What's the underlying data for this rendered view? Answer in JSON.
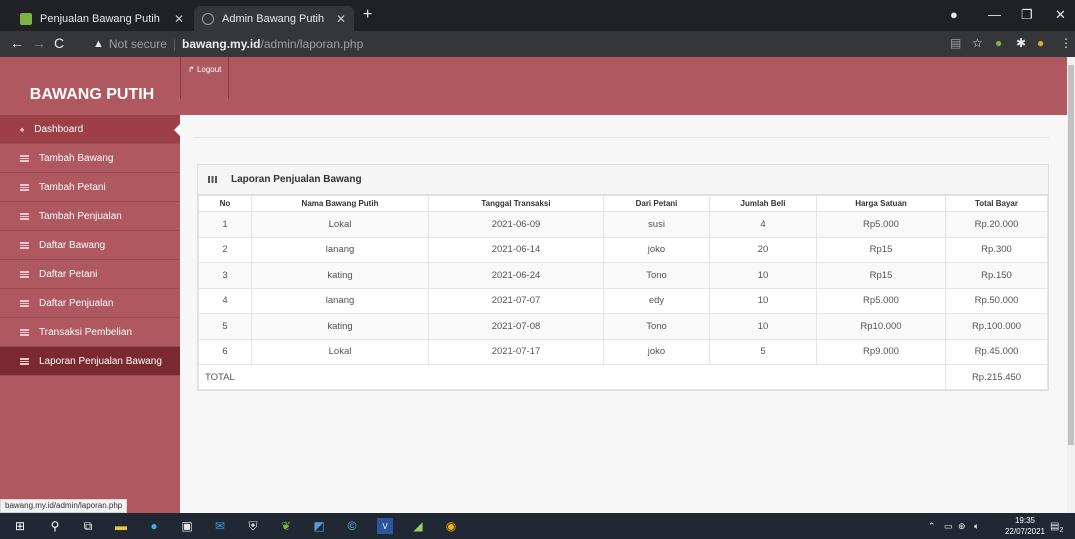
{
  "browser": {
    "tabs": [
      {
        "title": "Penjualan Bawang Putih"
      },
      {
        "title": "Admin Bawang Putih"
      }
    ],
    "security_label": "Not secure",
    "url_host": "bawang.my.id",
    "url_path": "/admin/laporan.php",
    "status_url": "bawang.my.id/admin/laporan.php"
  },
  "app": {
    "brand": "BAWANG PUTIH",
    "logout_label": "Logout"
  },
  "sidebar": {
    "items": [
      {
        "label": "Dashboard"
      },
      {
        "label": "Tambah Bawang"
      },
      {
        "label": "Tambah Petani"
      },
      {
        "label": "Tambah Penjualan"
      },
      {
        "label": "Daftar Bawang"
      },
      {
        "label": "Daftar Petani"
      },
      {
        "label": "Daftar Penjualan"
      },
      {
        "label": "Transaksi Pembelian"
      },
      {
        "label": "Laporan Penjualan Bawang"
      }
    ]
  },
  "report": {
    "title": "Laporan Penjualan Bawang",
    "columns": [
      "No",
      "Nama Bawang Putih",
      "Tanggal Transaksi",
      "Dari Petani",
      "Jumlah Beli",
      "Harga Satuan",
      "Total Bayar"
    ],
    "rows": [
      [
        "1",
        "Lokal",
        "2021-06-09",
        "susi",
        "4",
        "Rp5.000",
        "Rp.20.000"
      ],
      [
        "2",
        "lanang",
        "2021-06-14",
        "joko",
        "20",
        "Rp15",
        "Rp.300"
      ],
      [
        "3",
        "kating",
        "2021-06-24",
        "Tono",
        "10",
        "Rp15",
        "Rp.150"
      ],
      [
        "4",
        "lanang",
        "2021-07-07",
        "edy",
        "10",
        "Rp5.000",
        "Rp.50.000"
      ],
      [
        "5",
        "kating",
        "2021-07-08",
        "Tono",
        "10",
        "Rp10.000",
        "Rp.100.000"
      ],
      [
        "6",
        "Lokal",
        "2021-07-17",
        "joko",
        "5",
        "Rp9.000",
        "Rp.45.000"
      ]
    ],
    "total_label": "TOTAL",
    "total_value": "Rp.215.450"
  },
  "taskbar": {
    "time": "19:35",
    "date": "22/07/2021",
    "notification_count": "2"
  },
  "colors": {
    "accent": "#b0585f",
    "selected": "#7a2930"
  }
}
